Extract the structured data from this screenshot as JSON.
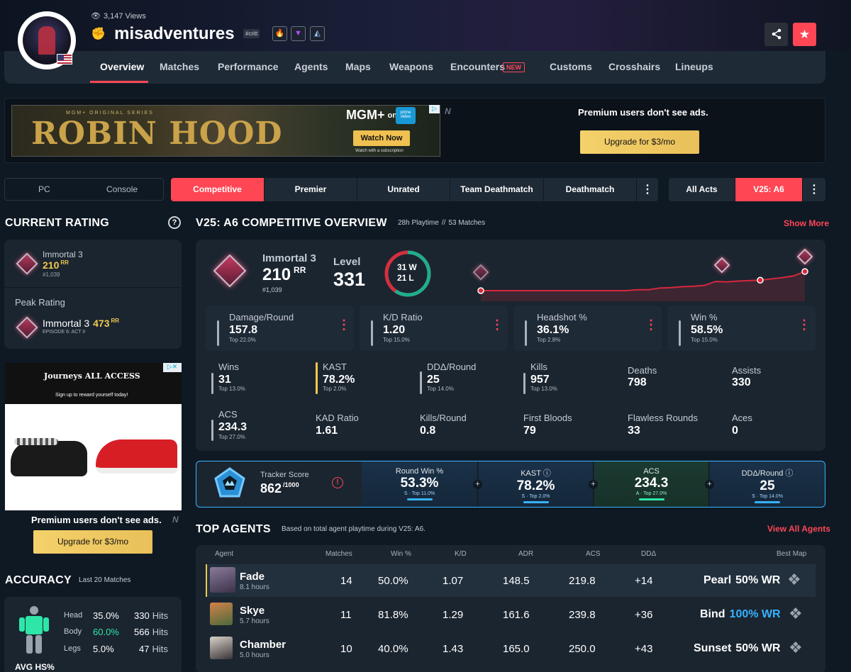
{
  "profile": {
    "views": "3,147 Views",
    "name": "misadventures",
    "tag": "#critt"
  },
  "nav": {
    "items": [
      "Overview",
      "Matches",
      "Performance",
      "Agents",
      "Maps",
      "Weapons",
      "Encounters",
      "Customs",
      "Crosshairs",
      "Lineups"
    ],
    "new_badge": "NEW"
  },
  "ad_top": {
    "series": "MGM+ ORIGINAL SERIES",
    "title": "ROBIN HOOD",
    "brand": "MGM+",
    "on": "on",
    "prime": "prime video",
    "cta": "Watch Now",
    "small": "Watch with a subscription",
    "premium_text": "Premium users don't see ads.",
    "upgrade": "Upgrade for $3/mo"
  },
  "filters": {
    "platforms": [
      "PC",
      "Console"
    ],
    "modes": [
      "Competitive",
      "Premier",
      "Unrated",
      "Team Deathmatch",
      "Deathmatch"
    ],
    "acts": [
      "All Acts",
      "V25: A6"
    ]
  },
  "current_rating": {
    "heading": "CURRENT RATING",
    "rank": "Immortal 3",
    "rr": "210",
    "rr_unit": "RR",
    "position": "#1,039",
    "peak_heading": "Peak Rating",
    "peak_rank": "Immortal 3",
    "peak_rr": "473",
    "peak_unit": "RR",
    "peak_episode": "EPISODE 6: ACT II"
  },
  "side_ad": {
    "brand": "Journeys ALL ACCESS",
    "tagline": "Sign up to reward yourself today!",
    "premium_text": "Premium users don't see ads.",
    "upgrade": "Upgrade for $3/mo"
  },
  "accuracy": {
    "heading": "ACCURACY",
    "sub": "Last 20 Matches",
    "rows": [
      {
        "part": "Head",
        "pct": "35.0%",
        "hits": "330",
        "unit": "Hits"
      },
      {
        "part": "Body",
        "pct": "60.0%",
        "hits": "566",
        "unit": "Hits"
      },
      {
        "part": "Legs",
        "pct": "5.0%",
        "hits": "47",
        "unit": "Hits"
      }
    ],
    "avg_label": "AVG HS%"
  },
  "overview": {
    "heading": "V25: A6 COMPETITIVE OVERVIEW",
    "playtime": "28h Playtime",
    "sep": "//",
    "matches": "53 Matches",
    "show_more": "Show More",
    "rank": "Immortal 3",
    "rr": "210",
    "rr_unit": "RR",
    "position": "#1,039",
    "level_label": "Level",
    "level": "331",
    "wins": "31",
    "w": "W",
    "losses": "21",
    "l": "L",
    "chart_data": {
      "type": "line",
      "title": "",
      "series": [
        {
          "values": [
            1,
            1,
            1,
            1,
            1,
            1,
            1,
            1,
            1,
            1,
            1,
            1,
            1,
            1,
            1.02,
            1.02,
            1.06,
            1.07,
            1.09,
            1.1,
            1.12,
            1.21,
            1.2,
            1.22,
            1.23,
            1.24,
            1.27,
            1.3,
            1.34,
            1.44
          ]
        }
      ]
    },
    "main_stats": [
      {
        "label": "Damage/Round",
        "value": "157.8",
        "top": "Top 22.0%"
      },
      {
        "label": "K/D Ratio",
        "value": "1.20",
        "top": "Top 15.0%"
      },
      {
        "label": "Headshot %",
        "value": "36.1%",
        "top": "Top 2.8%"
      },
      {
        "label": "Win %",
        "value": "58.5%",
        "top": "Top 15.0%"
      }
    ],
    "stats_row1": [
      {
        "label": "Wins",
        "value": "31",
        "top": "Top 13.0%"
      },
      {
        "label": "KAST",
        "value": "78.2%",
        "top": "Top 2.0%"
      },
      {
        "label": "DDΔ/Round",
        "value": "25",
        "top": "Top 14.0%"
      },
      {
        "label": "Kills",
        "value": "957",
        "top": "Top 13.0%"
      },
      {
        "label": "Deaths",
        "value": "798",
        "top": ""
      },
      {
        "label": "Assists",
        "value": "330",
        "top": ""
      }
    ],
    "stats_row2": [
      {
        "label": "ACS",
        "value": "234.3",
        "top": "Top 27.0%"
      },
      {
        "label": "KAD Ratio",
        "value": "1.61",
        "top": ""
      },
      {
        "label": "Kills/Round",
        "value": "0.8",
        "top": ""
      },
      {
        "label": "First Bloods",
        "value": "79",
        "top": ""
      },
      {
        "label": "Flawless Rounds",
        "value": "33",
        "top": ""
      },
      {
        "label": "Aces",
        "value": "0",
        "top": ""
      }
    ]
  },
  "tracker": {
    "label": "Tracker Score",
    "score": "862",
    "max": "/1000",
    "cells": [
      {
        "label": "Round Win %",
        "value": "53.3%",
        "sub": "S · Top 11.0%"
      },
      {
        "label": "KAST ⓘ",
        "value": "78.2%",
        "sub": "S · Top 2.0%"
      },
      {
        "label": "ACS",
        "value": "234.3",
        "sub": "A · Top 27.0%"
      },
      {
        "label": "DDΔ/Round ⓘ",
        "value": "25",
        "sub": "S · Top 14.0%"
      }
    ]
  },
  "top_agents": {
    "heading": "TOP AGENTS",
    "sub": "Based on total agent playtime during V25: A6.",
    "view_all": "View All Agents",
    "columns": [
      "Agent",
      "Matches",
      "Win %",
      "K/D",
      "ADR",
      "ACS",
      "DDΔ",
      "Best Map"
    ],
    "rows": [
      {
        "name": "Fade",
        "hours": "8.1 hours",
        "matches": "14",
        "win": "50.0%",
        "kd": "1.07",
        "adr": "148.5",
        "acs": "219.8",
        "dd": "+14",
        "map": "Pearl",
        "map_wr": "50% WR"
      },
      {
        "name": "Skye",
        "hours": "5.7 hours",
        "matches": "11",
        "win": "81.8%",
        "kd": "1.29",
        "adr": "161.6",
        "acs": "239.8",
        "dd": "+36",
        "map": "Bind",
        "map_wr": "100% WR"
      },
      {
        "name": "Chamber",
        "hours": "5.0 hours",
        "matches": "10",
        "win": "40.0%",
        "kd": "1.43",
        "adr": "165.0",
        "acs": "250.0",
        "dd": "+43",
        "map": "Sunset",
        "map_wr": "50% WR"
      }
    ]
  },
  "colors": {
    "accent": "#ff4655",
    "gold": "#f0c94d",
    "blue": "#36b3ff"
  }
}
